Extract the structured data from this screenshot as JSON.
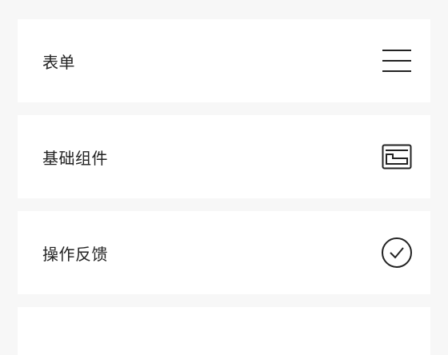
{
  "menu": {
    "items": [
      {
        "label": "表单",
        "icon": "menu-lines-icon"
      },
      {
        "label": "基础组件",
        "icon": "window-icon"
      },
      {
        "label": "操作反馈",
        "icon": "check-circle-icon"
      }
    ]
  }
}
